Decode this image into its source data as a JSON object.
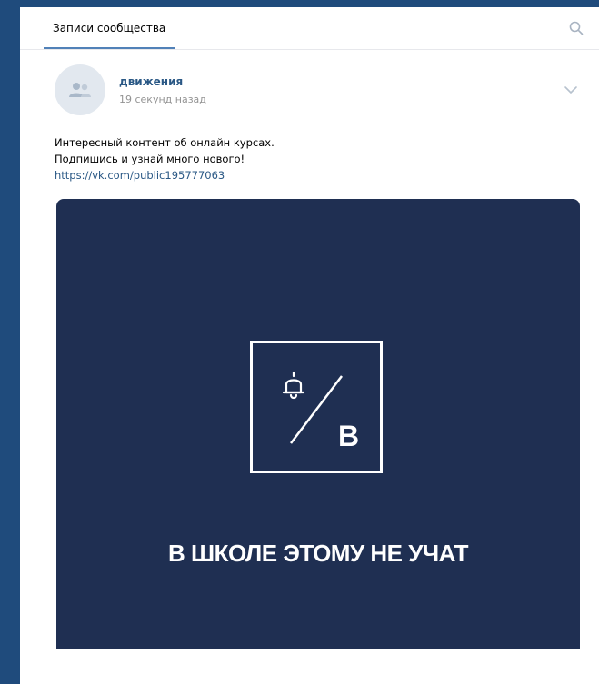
{
  "tabs": {
    "active_label": "Записи сообщества",
    "search_icon": "search-icon"
  },
  "post": {
    "author": "движения",
    "time": "19 секунд назад",
    "avatar_icon": "community-icon",
    "menu_icon": "chevron-down-icon",
    "text_lines": [
      "Интересный контент об онлайн курсах.",
      "Подпишись и узнай много нового!"
    ],
    "link": "https://vk.com/public195777063",
    "image": {
      "logo_letter": "B",
      "logo_icon": "bell-icon",
      "caption": "В ШКОЛЕ ЭТОМУ НЕ УЧАТ",
      "background": "#1f2f52"
    }
  },
  "colors": {
    "page_background": "#1f4b7c",
    "link": "#2a5885",
    "accent": "#5181b8"
  }
}
